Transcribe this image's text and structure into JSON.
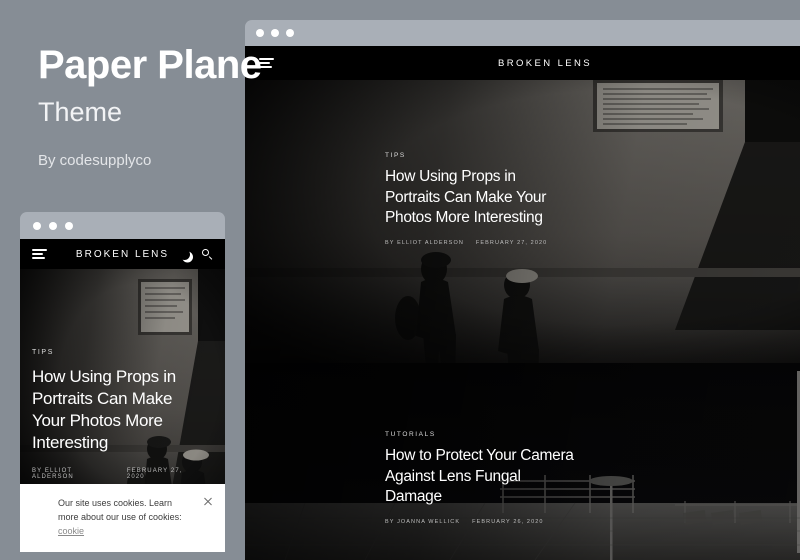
{
  "promo": {
    "title": "Paper Plane",
    "subtitle": "Theme",
    "author_line": "By codesupplyco"
  },
  "site": {
    "brand": "BROKEN LENS",
    "icons": {
      "menu": "hamburger-icon",
      "dark_mode": "moon-icon",
      "search": "search-icon"
    }
  },
  "desktop_mock": {
    "window_dots": 3,
    "articles": [
      {
        "category": "TIPS",
        "headline": "How Using Props in Portraits Can Make Your Photos More Interesting",
        "author": "BY ELLIOT ALDERSON",
        "date": "FEBRUARY 27, 2020"
      },
      {
        "category": "TUTORIALS",
        "headline": "How to Protect Your Camera Against Lens Fungal Damage",
        "author": "BY JOANNA WELLICK",
        "date": "FEBRUARY 26, 2020"
      }
    ]
  },
  "mobile_mock": {
    "window_dots": 3,
    "articles": [
      {
        "category": "TIPS",
        "headline": "How Using Props in Portraits Can Make Your Photos More Interesting",
        "author": "BY ELLIOT ALDERSON",
        "date": "FEBRUARY 27, 2020"
      }
    ],
    "cookie_notice": {
      "text": "Our site uses cookies. Learn more about our use of cookies: ",
      "link": "cookie",
      "close": "×"
    }
  },
  "colors": {
    "background": "#868d95",
    "chrome": "#a9afb7",
    "site_bg": "#000000",
    "text_light": "#ffffff"
  }
}
